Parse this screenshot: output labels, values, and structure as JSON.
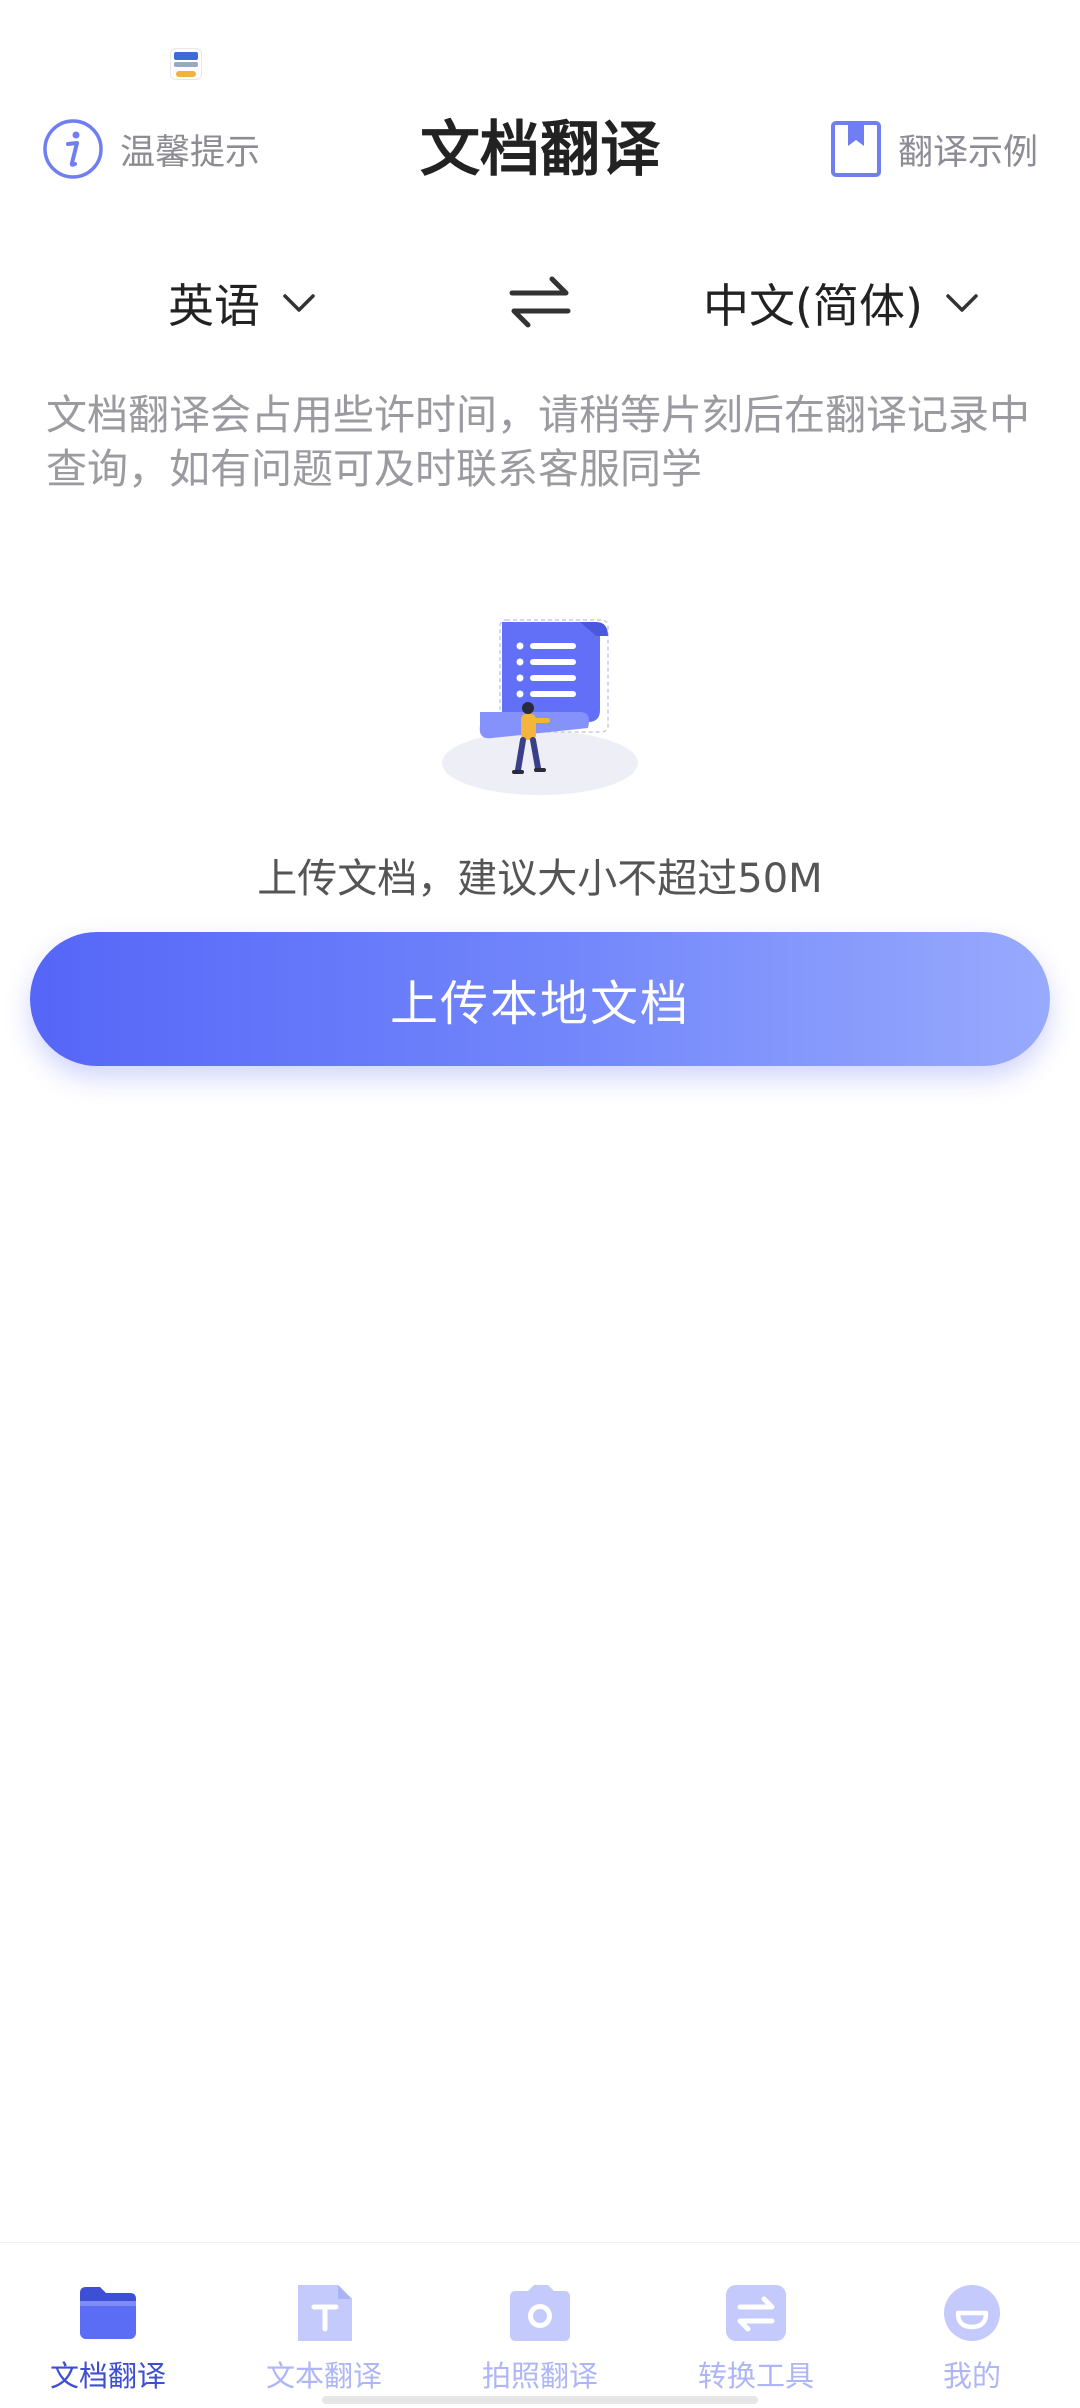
{
  "header": {
    "tips_label": "温馨提示",
    "title": "文档翻译",
    "example_label": "翻译示例"
  },
  "languages": {
    "source": "英语",
    "target": "中文(简体)"
  },
  "description": "文档翻译会占用些许时间，请稍等片刻后在翻译记录中查询，如有问题可及时联系客服同学",
  "upload": {
    "hint": "上传文档，建议大小不超过50M",
    "button_label": "上传本地文档"
  },
  "bottom_nav": {
    "items": [
      {
        "label": "文档翻译",
        "icon": "folder-icon",
        "active": true
      },
      {
        "label": "文本翻译",
        "icon": "text-document-icon",
        "active": false
      },
      {
        "label": "拍照翻译",
        "icon": "camera-icon",
        "active": false
      },
      {
        "label": "转换工具",
        "icon": "convert-icon",
        "active": false
      },
      {
        "label": "我的",
        "icon": "profile-icon",
        "active": false
      }
    ]
  },
  "colors": {
    "accent": "#5566f8",
    "active_nav": "#3d4fd0",
    "inactive_nav": "#aeb6f6",
    "text_primary": "#222222",
    "text_secondary": "#9a9aa0"
  }
}
